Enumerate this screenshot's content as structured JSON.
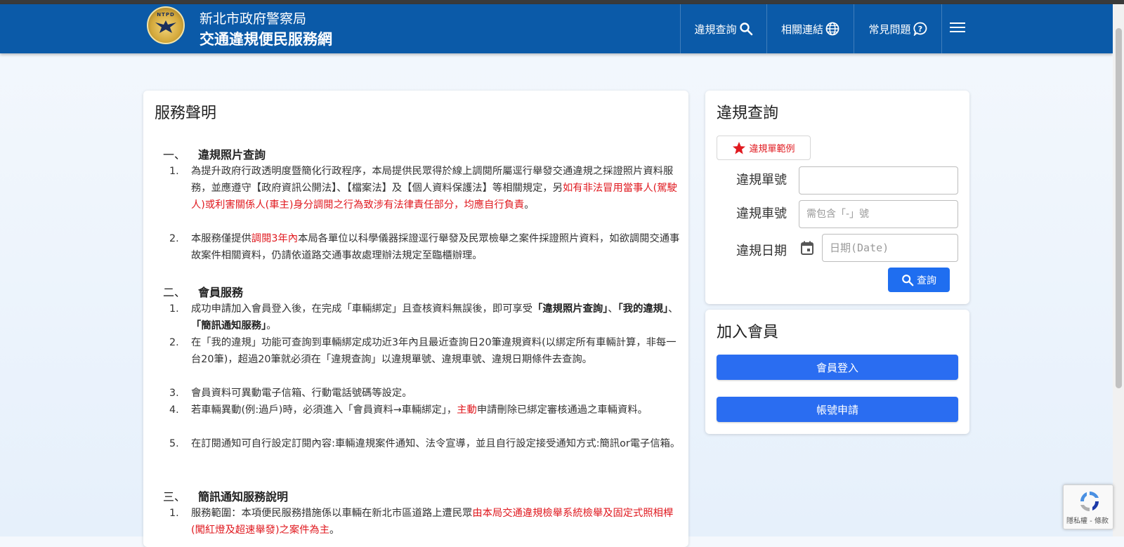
{
  "header": {
    "org_name": "新北市政府警察局",
    "site_name": "交通違規便民服務網",
    "logo_text": "NTPD",
    "nav": [
      {
        "label": "違規查詢",
        "icon": "search-icon"
      },
      {
        "label": "相關連結",
        "icon": "globe-icon"
      },
      {
        "label": "常見問題",
        "icon": "question-icon"
      }
    ],
    "menu_icon": "hamburger-menu-icon"
  },
  "statement": {
    "title": "服務聲明",
    "sections": [
      {
        "num": "一、",
        "title": "違規照片查詢",
        "items": [
          {
            "n": "1.",
            "parts": [
              "為提升政府行政透明度暨簡化行政程序，本局提供民眾得於線上調閱所屬逕行舉發交通違規之採證照片資料服務，並應遵守【政府資訊公開法】、【檔案法】及【個人資料保護法】等相關規定，另",
              "如有非法冒用當事人(駕駛人)或利害關係人(車主)身分調閱之行為致涉有法律責任部分，均應自行負責",
              "。"
            ]
          },
          {
            "n": "2.",
            "parts": [
              "本服務僅提供",
              "調閱3年內",
              "本局各單位以科學儀器採證逕行舉發及民眾檢舉之案件採證照片資料，如欲調閱交通事故案件相關資料，仍請依道路交通事故處理辦法規定至臨櫃辦理。"
            ]
          }
        ]
      },
      {
        "num": "二、",
        "title": "會員服務",
        "items": [
          {
            "n": "1.",
            "parts": [
              "成功申請加入會員登入後，在完成「車輛綁定」且查核資料無誤後，即可享受",
              "「違規照片查詢」",
              "、",
              "「我的違規」",
              "、",
              "「簡訊通知服務」",
              "。"
            ]
          },
          {
            "n": "2.",
            "parts": [
              "在「我的違規」功能可查詢到車輛綁定成功近3年內且最近查詢日20筆違規資料(以綁定所有車輛計算，非每一台20筆)，超過20筆就必須在「違規查詢」以違規單號、違規車號、違規日期條件去查詢。"
            ]
          },
          {
            "n": "3.",
            "parts": [
              "會員資料可異動電子信箱、行動電話號碼等設定。"
            ]
          },
          {
            "n": "4.",
            "parts": [
              "若車輛異動(例:過戶)時，必須進入「會員資料→車輛綁定」，",
              "主動",
              "申請刪除已綁定審核通過之車輛資料。"
            ]
          },
          {
            "n": "5.",
            "parts": [
              "在訂閱通知可自行設定訂閱內容:車輛違規案件通知、法令宣導，並且自行設定接受通知方式:簡訊or電子信箱。"
            ]
          }
        ]
      },
      {
        "num": "三、",
        "title": "簡訊通知服務說明",
        "items": [
          {
            "n": "1.",
            "parts": [
              "服務範圍：本項便民服務措施係以車輛在新北市區道路上遭民眾",
              "由本局交通違規檢舉系統檢舉及固定式照相桿(闖紅燈及超速舉發)之案件為主",
              "。"
            ]
          }
        ]
      }
    ]
  },
  "query": {
    "title": "違規查詢",
    "example_label": "違規單範例",
    "ticket_label": "違規單號",
    "ticket_value": "",
    "plate_label": "違規車號",
    "plate_placeholder": "需包含「-」號",
    "date_label": "違規日期",
    "date_placeholder": "日期(Date)",
    "submit_label": "查詢"
  },
  "member": {
    "title": "加入會員",
    "login_label": "會員登入",
    "register_label": "帳號申請"
  },
  "recaptcha": {
    "text": "隱私權 - 條款"
  },
  "colors": {
    "navbar": "#0b5aa8",
    "accent_red": "#e0191f",
    "primary_button": "#2a6df1"
  }
}
